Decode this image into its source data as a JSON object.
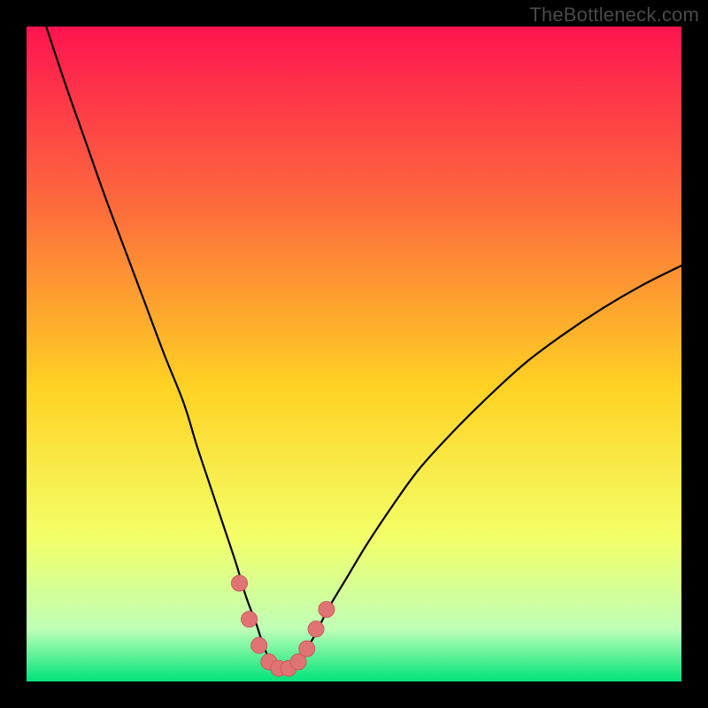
{
  "watermark": "TheBottleneck.com",
  "colors": {
    "frame": "#000000",
    "curve": "#000000",
    "marker_fill": "#e07474",
    "marker_stroke": "#c85a5a",
    "grad_top": "#ff1450",
    "grad_q1": "#fd6d3c",
    "grad_mid": "#ffd223",
    "grad_q3": "#f3ff68",
    "grad_green_top": "#bfffb7",
    "grad_green_bot": "#00e47a"
  },
  "chart_data": {
    "type": "line",
    "title": "",
    "xlabel": "",
    "ylabel": "",
    "xlim": [
      0,
      100
    ],
    "ylim": [
      0,
      100
    ],
    "curve": {
      "name": "bottleneck-curve",
      "x": [
        3,
        6,
        9,
        12,
        15,
        18,
        21,
        24,
        26,
        28,
        30,
        32,
        33.5,
        35,
        36,
        37,
        38,
        39,
        40.5,
        42,
        44,
        46,
        49,
        52,
        56,
        60,
        65,
        70,
        76,
        82,
        88,
        94,
        100
      ],
      "y": [
        100,
        91,
        82.5,
        74,
        66,
        58,
        50,
        42.5,
        36,
        30,
        24,
        18,
        13,
        9,
        6,
        3.5,
        2,
        2,
        2.5,
        4,
        7,
        11,
        16,
        21,
        27,
        32.5,
        38,
        43,
        48.5,
        53,
        57,
        60.5,
        63.5
      ]
    },
    "markers": {
      "name": "highlighted-points",
      "x": [
        32.5,
        34,
        35.5,
        37,
        38.5,
        40,
        41.5,
        42.8,
        44.2,
        45.8
      ],
      "y": [
        15,
        9.5,
        5.5,
        3,
        2,
        2,
        3,
        5,
        8,
        11
      ]
    }
  }
}
